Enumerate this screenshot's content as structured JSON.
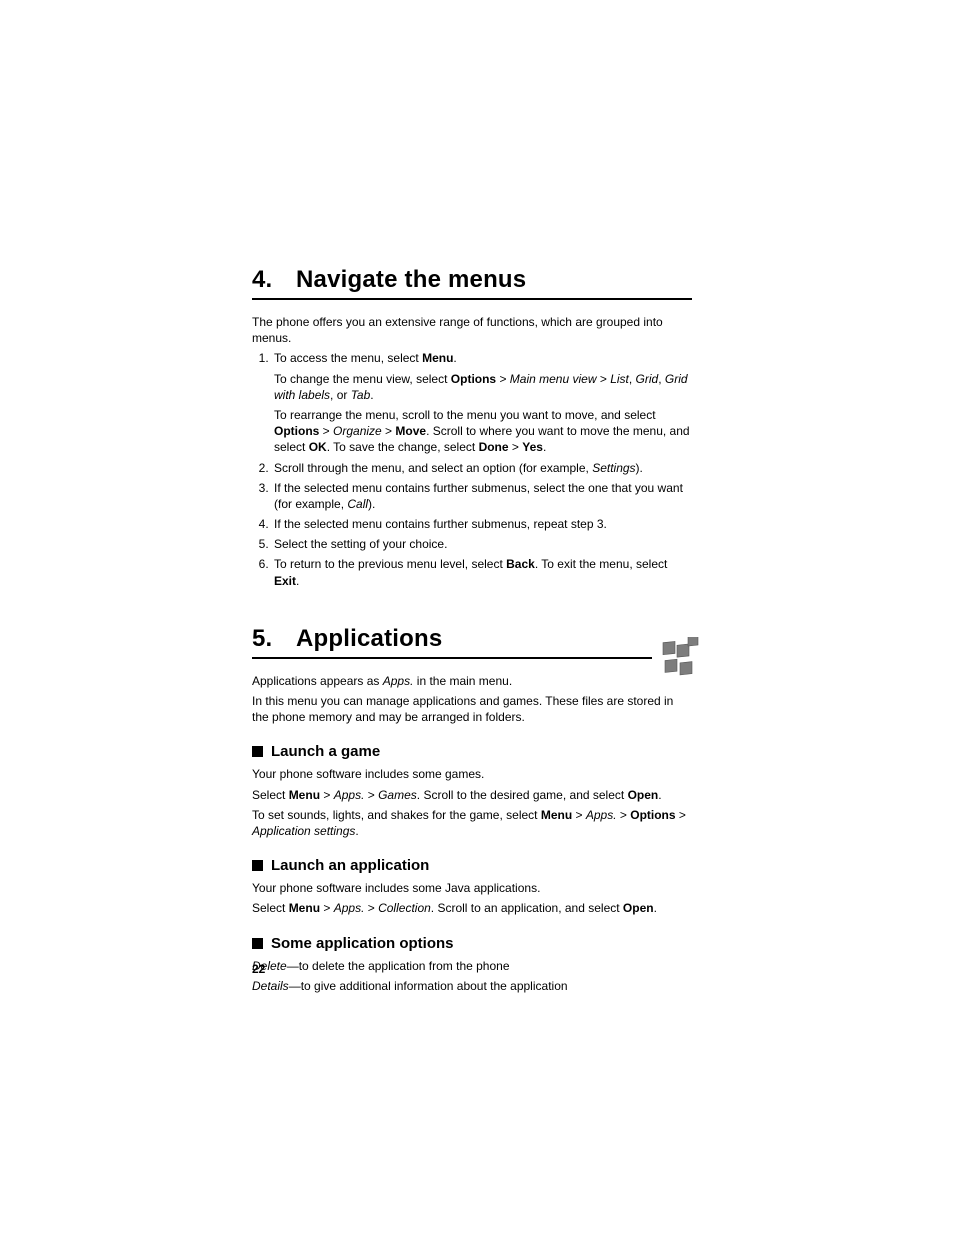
{
  "section4": {
    "heading_num": "4.",
    "heading_text": "Navigate the menus",
    "intro": "The phone offers you an extensive range of functions, which are grouped into menus.",
    "steps": [
      {
        "main_pre": "To access the menu, select ",
        "main_b1": "Menu",
        "main_post": ".",
        "sub1": {
          "t1": "To change the menu view, select ",
          "b1": "Options",
          "t2": " > ",
          "i1": "Main menu view",
          "t3": " > ",
          "i2": "List",
          "t4": ", ",
          "i3": "Grid",
          "t5": ", ",
          "i4": "Grid with labels",
          "t6": ", or ",
          "i5": "Tab",
          "t7": "."
        },
        "sub2": {
          "t1": "To rearrange the menu, scroll to the menu you want to move, and select ",
          "b1": "Options",
          "t2": " > ",
          "i1": "Organize",
          "t3": " > ",
          "b2": "Move",
          "t4": ". Scroll to where you want to move the menu, and select ",
          "b3": "OK",
          "t5": ". To save the change, select ",
          "b4": "Done",
          "t6": " > ",
          "b5": "Yes",
          "t7": "."
        }
      },
      {
        "t1": "Scroll through the menu, and select an option (for example, ",
        "i1": "Settings",
        "t2": ")."
      },
      {
        "t1": "If the selected menu contains further submenus, select the one that you want (for example, ",
        "i1": "Call",
        "t2": ")."
      },
      {
        "t1": "If the selected menu contains further submenus, repeat step 3."
      },
      {
        "t1": "Select the setting of your choice."
      },
      {
        "t1": "To return to the previous menu level, select ",
        "b1": "Back",
        "t2": ". To exit the menu, select ",
        "b2": "Exit",
        "t3": "."
      }
    ]
  },
  "section5": {
    "heading_num": "5.",
    "heading_text": "Applications",
    "p1": {
      "t1": "Applications appears as ",
      "i1": "Apps.",
      "t2": " in the main menu."
    },
    "p2": "In this menu you can manage applications and games. These files are stored in the phone memory and may be arranged in folders.",
    "launch_game": {
      "title": "Launch a game",
      "p1": "Your phone software includes some games.",
      "p2": {
        "t1": "Select ",
        "b1": "Menu",
        "t2": " > ",
        "i1": "Apps.",
        "t3": " > ",
        "i2": "Games",
        "t4": ". Scroll to the desired game, and select ",
        "b2": "Open",
        "t5": "."
      },
      "p3": {
        "t1": "To set sounds, lights, and shakes for the game, select ",
        "b1": "Menu",
        "t2": " > ",
        "i1": "Apps.",
        "t3": " > ",
        "b2": "Options",
        "t4": " > ",
        "i2": "Application settings",
        "t5": "."
      }
    },
    "launch_app": {
      "title": "Launch an application",
      "p1": "Your phone software includes some Java applications.",
      "p2": {
        "t1": "Select ",
        "b1": "Menu",
        "t2": " > ",
        "i1": "Apps.",
        "t3": " > ",
        "i2": "Collection",
        "t4": ". Scroll to an application, and select ",
        "b2": "Open",
        "t5": "."
      }
    },
    "options": {
      "title": "Some application options",
      "p1": {
        "i1": "Delete",
        "t1": "—to delete the application from the phone"
      },
      "p2": {
        "i1": "Details",
        "t1": "—to give additional information about the application"
      }
    }
  },
  "page_number": "22"
}
